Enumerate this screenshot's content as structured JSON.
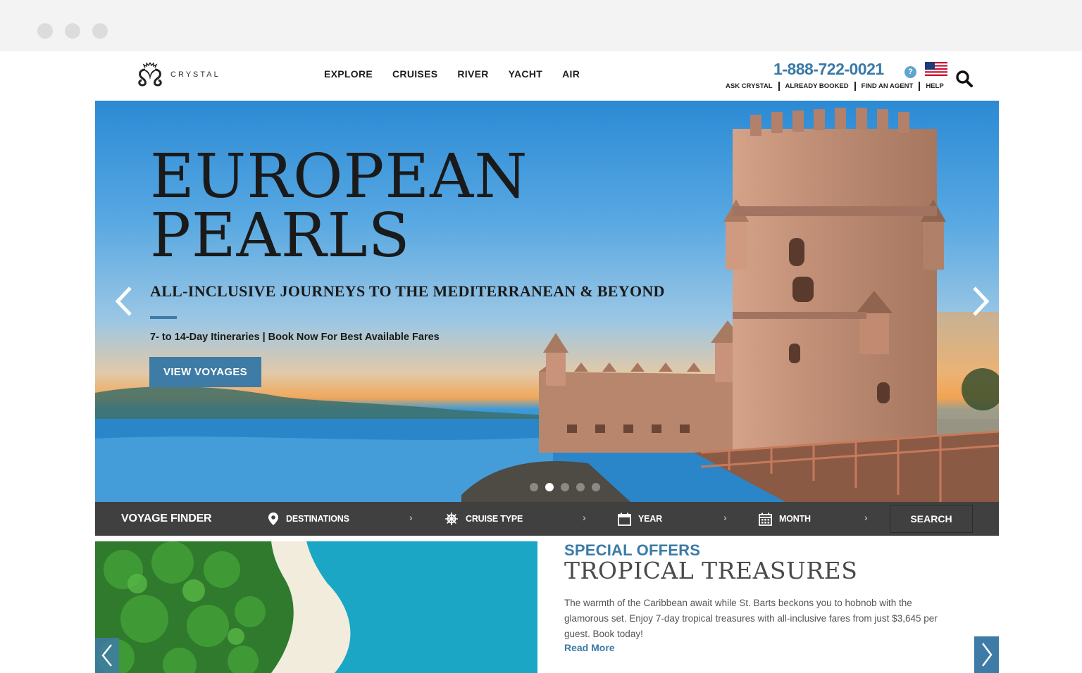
{
  "brand": {
    "name": "CRYSTAL",
    "logo_icon": "crystal-seahorse-logo",
    "accent": "#3e7ba6"
  },
  "nav": {
    "items": [
      {
        "label": "EXPLORE"
      },
      {
        "label": "CRUISES"
      },
      {
        "label": "RIVER"
      },
      {
        "label": "YACHT"
      },
      {
        "label": "AIR"
      }
    ]
  },
  "utility": {
    "phone": "1-888-722-0021",
    "help_badge": "?",
    "flag_icon": "us-flag-icon",
    "links": [
      {
        "label": "ASK CRYSTAL"
      },
      {
        "label": "ALREADY BOOKED"
      },
      {
        "label": "FIND AN AGENT"
      },
      {
        "label": "HELP"
      }
    ]
  },
  "hero": {
    "title_line1": "EUROPEAN",
    "title_line2": "PEARLS",
    "subtitle": "ALL-INCLUSIVE JOURNEYS TO THE MEDITERRANEAN & BEYOND",
    "description": "7- to 14-Day Itineraries | Book Now For Best Available Fares",
    "button": "VIEW VOYAGES",
    "slide_count": 5,
    "active_slide": 2
  },
  "voyage_finder": {
    "title": "VOYAGE FINDER",
    "fields": [
      {
        "label": "DESTINATIONS",
        "icon": "map-pin-icon"
      },
      {
        "label": "CRUISE TYPE",
        "icon": "ship-wheel-icon"
      },
      {
        "label": "YEAR",
        "icon": "calendar-icon"
      },
      {
        "label": "MONTH",
        "icon": "calendar-grid-icon"
      }
    ],
    "search": "SEARCH"
  },
  "special_offer": {
    "eyebrow": "SPECIAL OFFERS",
    "title": "TROPICAL TREASURES",
    "description": "The warmth of the Caribbean await while St. Barts beckons you to hobnob with the glamorous set. Enjoy 7-day tropical treasures with all-inclusive fares from just $3,645 per guest. Book today!",
    "link": "Read More"
  }
}
